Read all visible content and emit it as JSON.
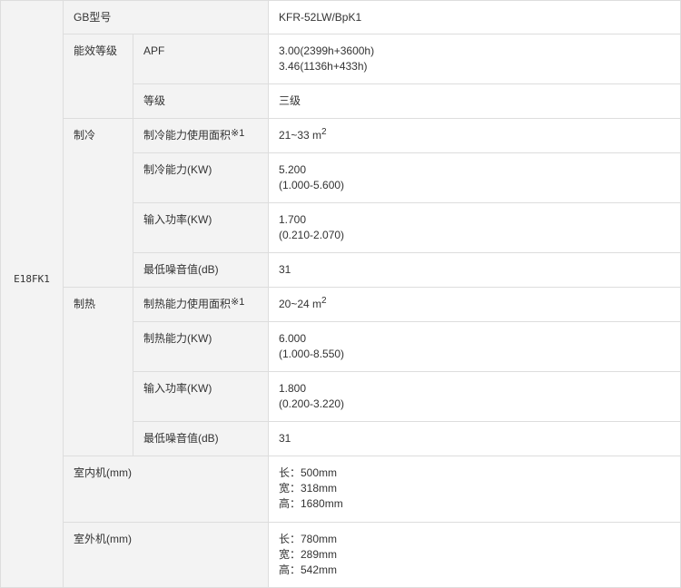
{
  "model": "E18FK1",
  "gb_model": {
    "label": "GB型号",
    "value": "KFR-52LW/BpK1"
  },
  "efficiency": {
    "label": "能效等级",
    "apf": {
      "label": "APF",
      "lines": [
        "3.00(2399h+3600h)",
        "3.46(1136h+433h)"
      ]
    },
    "grade": {
      "label": "等级",
      "value": "三级"
    }
  },
  "cooling": {
    "label": "制冷",
    "area": {
      "label": "制冷能力使用面积",
      "note": "※1",
      "value": "21~33 m",
      "sup": "2"
    },
    "capacity": {
      "label": "制冷能力(KW)",
      "lines": [
        "5.200",
        "(1.000-5.600)"
      ]
    },
    "input_power": {
      "label": "输入功率(KW)",
      "lines": [
        "1.700",
        "(0.210-2.070)"
      ]
    },
    "min_noise": {
      "label": "最低噪音值(dB)",
      "value": "31"
    }
  },
  "heating": {
    "label": "制热",
    "area": {
      "label": "制热能力使用面积",
      "note": "※1",
      "value": "20~24 m",
      "sup": "2"
    },
    "capacity": {
      "label": "制热能力(KW)",
      "lines": [
        "6.000",
        "(1.000-8.550)"
      ]
    },
    "input_power": {
      "label": "输入功率(KW)",
      "lines": [
        "1.800",
        "(0.200-3.220)"
      ]
    },
    "min_noise": {
      "label": "最低噪音值(dB)",
      "value": "31"
    }
  },
  "indoor_unit": {
    "label": "室内机(mm)",
    "lines": [
      "长：500mm",
      "宽：318mm",
      "高：1680mm"
    ]
  },
  "outdoor_unit": {
    "label": "室外机(mm)",
    "lines": [
      "长：780mm",
      "宽：289mm",
      "高：542mm"
    ]
  },
  "colors": {
    "label_bg": "#f3f3f3",
    "value_bg": "#ffffff",
    "border": "#dddddd",
    "text": "#333333"
  }
}
